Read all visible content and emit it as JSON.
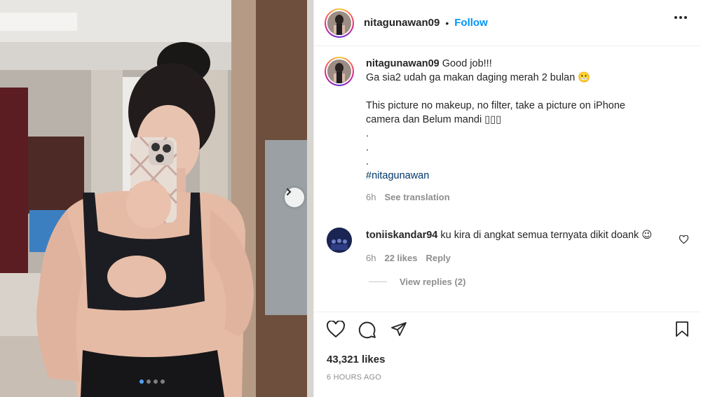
{
  "post": {
    "username": "nitagunawan09",
    "separator": "•",
    "follow_label": "Follow",
    "more_icon": "more-horizontal-icon"
  },
  "caption": {
    "username": "nitagunawan09",
    "line1": "Good job!!!",
    "line2": "Ga sia2 udah ga makan daging merah 2 bulan 😬",
    "line3": "This picture no makeup, no filter, take a picture on iPhone",
    "line4": "camera dan Belum mandi ▯▯▯",
    "dot1": ".",
    "dot2": ".",
    "dot3": ".",
    "hashtag": "#nitagunawan",
    "time": "6h",
    "see_translation": "See translation"
  },
  "comment": {
    "username": "toniiskandar94",
    "text": "ku kira di angkat semua ternyata dikit doank 😉",
    "time": "6h",
    "likes": "22 likes",
    "reply_label": "Reply",
    "view_replies": "View replies (2)"
  },
  "footer": {
    "likes": "43,321 likes",
    "timestamp": "6 HOURS AGO"
  },
  "carousel": {
    "slide_count": 4,
    "active_slide": 1
  },
  "colors": {
    "accent": "#0095f6",
    "hashtag": "#00376b",
    "muted": "#8e8e8e",
    "text": "#262626"
  }
}
